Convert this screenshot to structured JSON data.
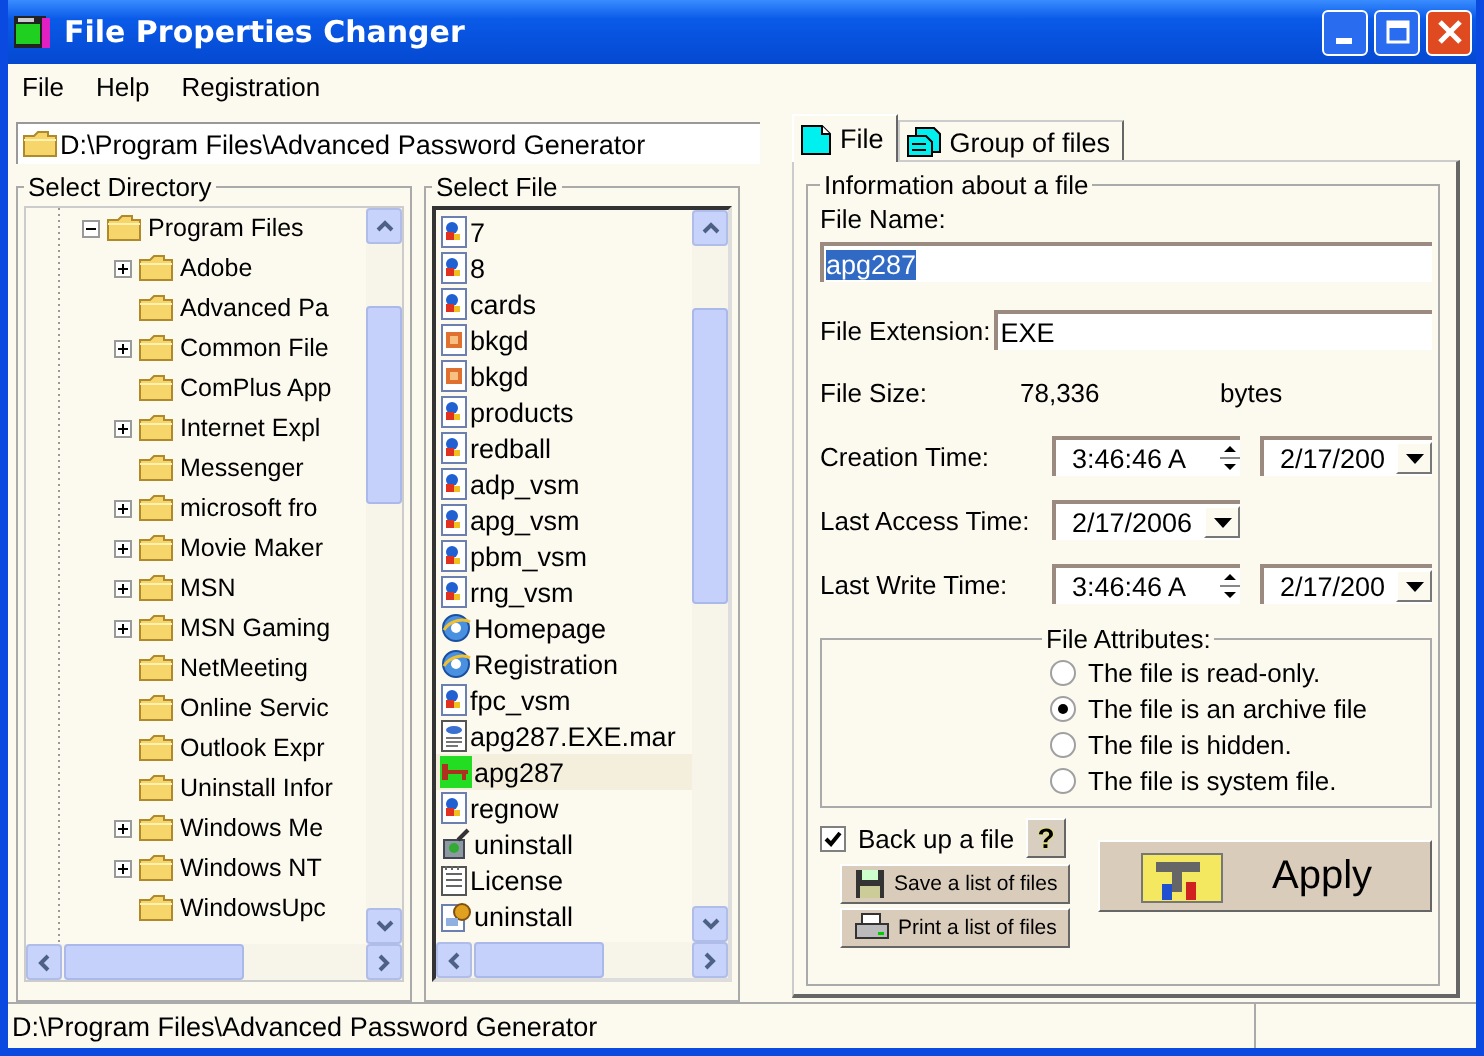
{
  "window": {
    "title": "File Properties Changer"
  },
  "menu": [
    "File",
    "Help",
    "Registration"
  ],
  "path_field": {
    "value": "D:\\Program Files\\Advanced Password Generator"
  },
  "directory_group": {
    "title": "Select Directory",
    "tree": [
      {
        "label": "Program Files",
        "expanded": true,
        "children": [
          {
            "label": "Adobe",
            "expandable": true
          },
          {
            "label": "Advanced Pa",
            "expandable": false
          },
          {
            "label": "Common File",
            "expandable": true
          },
          {
            "label": "ComPlus App",
            "expandable": false
          },
          {
            "label": "Internet Expl",
            "expandable": true
          },
          {
            "label": "Messenger",
            "expandable": false
          },
          {
            "label": "microsoft fro",
            "expandable": true
          },
          {
            "label": "Movie Maker",
            "expandable": true
          },
          {
            "label": "MSN",
            "expandable": true
          },
          {
            "label": "MSN Gaming",
            "expandable": true
          },
          {
            "label": "NetMeeting",
            "expandable": false
          },
          {
            "label": "Online Servic",
            "expandable": false
          },
          {
            "label": "Outlook Expr",
            "expandable": false
          },
          {
            "label": "Uninstall Infor",
            "expandable": false
          },
          {
            "label": "Windows Me",
            "expandable": true
          },
          {
            "label": "Windows NT",
            "expandable": true
          },
          {
            "label": "WindowsUpc",
            "expandable": false
          }
        ]
      }
    ]
  },
  "file_group": {
    "title": "Select File",
    "files": [
      {
        "name": "7",
        "kind": "document",
        "selected": false
      },
      {
        "name": "8",
        "kind": "document",
        "selected": false
      },
      {
        "name": "cards",
        "kind": "document",
        "selected": false
      },
      {
        "name": "bkgd",
        "kind": "image",
        "selected": false
      },
      {
        "name": "bkgd",
        "kind": "image",
        "selected": false
      },
      {
        "name": "products",
        "kind": "document",
        "selected": false
      },
      {
        "name": "redball",
        "kind": "document",
        "selected": false
      },
      {
        "name": "adp_vsm",
        "kind": "document",
        "selected": false
      },
      {
        "name": "apg_vsm",
        "kind": "document",
        "selected": false
      },
      {
        "name": "pbm_vsm",
        "kind": "document",
        "selected": false
      },
      {
        "name": "rng_vsm",
        "kind": "document",
        "selected": false
      },
      {
        "name": "Homepage",
        "kind": "web",
        "selected": false
      },
      {
        "name": "Registration",
        "kind": "web",
        "selected": false
      },
      {
        "name": "fpc_vsm",
        "kind": "document",
        "selected": false
      },
      {
        "name": "apg287.EXE.mar",
        "kind": "manifest",
        "selected": false
      },
      {
        "name": "apg287",
        "kind": "key",
        "selected": true
      },
      {
        "name": "regnow",
        "kind": "document",
        "selected": false
      },
      {
        "name": "uninstall",
        "kind": "setup",
        "selected": false
      },
      {
        "name": "License",
        "kind": "text",
        "selected": false
      },
      {
        "name": "uninstall",
        "kind": "installer",
        "selected": false
      }
    ]
  },
  "tabs": [
    {
      "label": "File",
      "kind": "file",
      "selected": true
    },
    {
      "label": "Group of files",
      "kind": "group",
      "selected": false
    }
  ],
  "info": {
    "title": "Information about a file",
    "file_name_label": "File Name:",
    "file_name": "apg287",
    "extension_label": "File Extension:",
    "extension": "EXE",
    "size_label": "File Size:",
    "size": "78,336",
    "size_unit": "bytes",
    "creation_label": "Creation Time:",
    "creation_time": "3:46:46 A",
    "creation_date": "2/17/200",
    "access_label": "Last Access Time:",
    "access_date": "2/17/2006",
    "write_label": "Last Write Time:",
    "write_time": "3:46:46 A",
    "write_date": "2/17/200"
  },
  "attributes": {
    "title": "File Attributes:",
    "options": [
      {
        "label": "The file is read-only.",
        "selected": false
      },
      {
        "label": "The file is an archive file",
        "selected": true
      },
      {
        "label": "The file is hidden.",
        "selected": false
      },
      {
        "label": "The file is system file.",
        "selected": false
      }
    ]
  },
  "backup": {
    "label": "Back up a file",
    "checked": true,
    "help": "?"
  },
  "buttons": {
    "save": "Save a list of files",
    "print": "Print a list of files",
    "apply": "Apply"
  },
  "status_bar": {
    "text": "D:\\Program Files\\Advanced Password Generator"
  }
}
